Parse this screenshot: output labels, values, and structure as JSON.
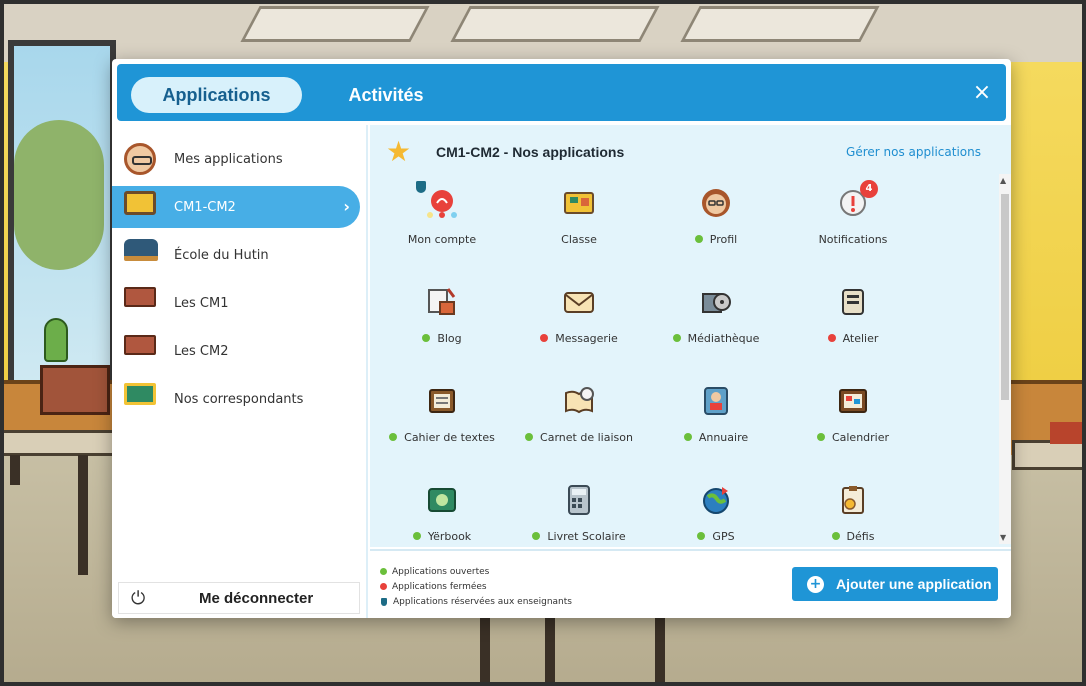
{
  "tabs": [
    {
      "label": "Applications",
      "active": true
    },
    {
      "label": "Activités",
      "active": false
    }
  ],
  "close_label": "×",
  "sidebar": {
    "items": [
      {
        "label": "Mes applications",
        "icon": "avatar-icon"
      },
      {
        "label": "CM1-CM2",
        "icon": "classboard-icon",
        "selected": true
      },
      {
        "label": "École du Hutin",
        "icon": "school-icon"
      },
      {
        "label": "Les CM1",
        "icon": "desks-icon"
      },
      {
        "label": "Les CM2",
        "icon": "desks-icon"
      },
      {
        "label": "Nos correspondants",
        "icon": "correspondents-icon"
      }
    ],
    "chevron": "›",
    "logout_icon": "⏻",
    "logout_label": "Me déconnecter"
  },
  "main": {
    "title": "CM1-CM2 - Nos applications",
    "manage_link": "Gérer nos applications",
    "apps": [
      {
        "label": "Mon compte",
        "status": "none",
        "icon": "account-icon"
      },
      {
        "label": "Classe",
        "status": "none",
        "icon": "classboard-icon"
      },
      {
        "label": "Profil",
        "status": "open",
        "icon": "avatar-icon"
      },
      {
        "label": "Notifications",
        "status": "none",
        "icon": "notification-icon",
        "badge": "4"
      },
      {
        "label": "Blog",
        "status": "open",
        "icon": "blog-icon"
      },
      {
        "label": "Messagerie",
        "status": "closed",
        "icon": "envelope-icon"
      },
      {
        "label": "Médiathèque",
        "status": "open",
        "icon": "media-icon"
      },
      {
        "label": "Atelier",
        "status": "closed",
        "icon": "workshop-icon"
      },
      {
        "label": "Cahier de textes",
        "status": "open",
        "icon": "textbook-icon"
      },
      {
        "label": "Carnet de liaison",
        "status": "open",
        "icon": "notebook-icon"
      },
      {
        "label": "Annuaire",
        "status": "open",
        "icon": "directory-icon"
      },
      {
        "label": "Calendrier",
        "status": "open",
        "icon": "calendar-icon"
      },
      {
        "label": "Yërbook",
        "status": "open",
        "icon": "yearbook-icon"
      },
      {
        "label": "Livret Scolaire",
        "status": "open",
        "icon": "calculator-icon"
      },
      {
        "label": "GPS",
        "status": "open",
        "icon": "globe-icon"
      },
      {
        "label": "Défis",
        "status": "open",
        "icon": "challenge-icon"
      }
    ]
  },
  "legend": {
    "open": "Applications ouvertes",
    "closed": "Applications fermées",
    "teacher": "Applications réservées aux enseignants"
  },
  "add_button_label": "Ajouter une application",
  "colors": {
    "header_blue": "#1f95d6",
    "panel_bg": "#e3f4fb",
    "open_green": "#6bbf3b",
    "closed_red": "#e8413b"
  }
}
